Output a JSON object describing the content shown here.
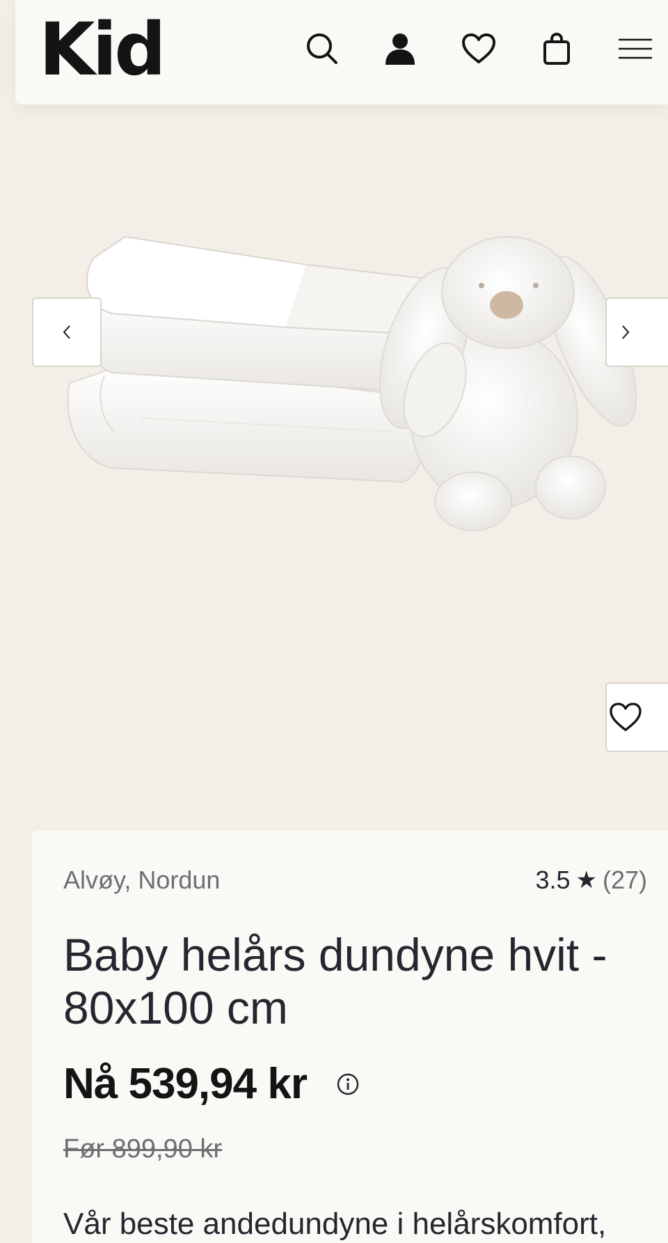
{
  "header": {
    "logo": "Kid",
    "icons": [
      "search-icon",
      "user-icon",
      "heart-icon",
      "bag-icon",
      "menu-icon"
    ]
  },
  "gallery": {
    "image_alt": "Baby helårs dundyne hvit og kosebamse",
    "prev_glyph": "‹",
    "next_glyph": "›"
  },
  "product": {
    "brand": "Alvøy, Nordun",
    "rating": "3.5",
    "rating_star": "★",
    "rating_count": "(27)",
    "title": "Baby helårs dundyne hvit - 80x100 cm",
    "price": "Nå 539,94 kr",
    "old_price": "Før 899,90 kr",
    "description": "Vår beste andedundyne i helårskomfort,"
  },
  "colors": {
    "background": "#f3efe8",
    "card": "#fbf9f5",
    "text": "#27252f",
    "muted": "#6f6c74"
  }
}
